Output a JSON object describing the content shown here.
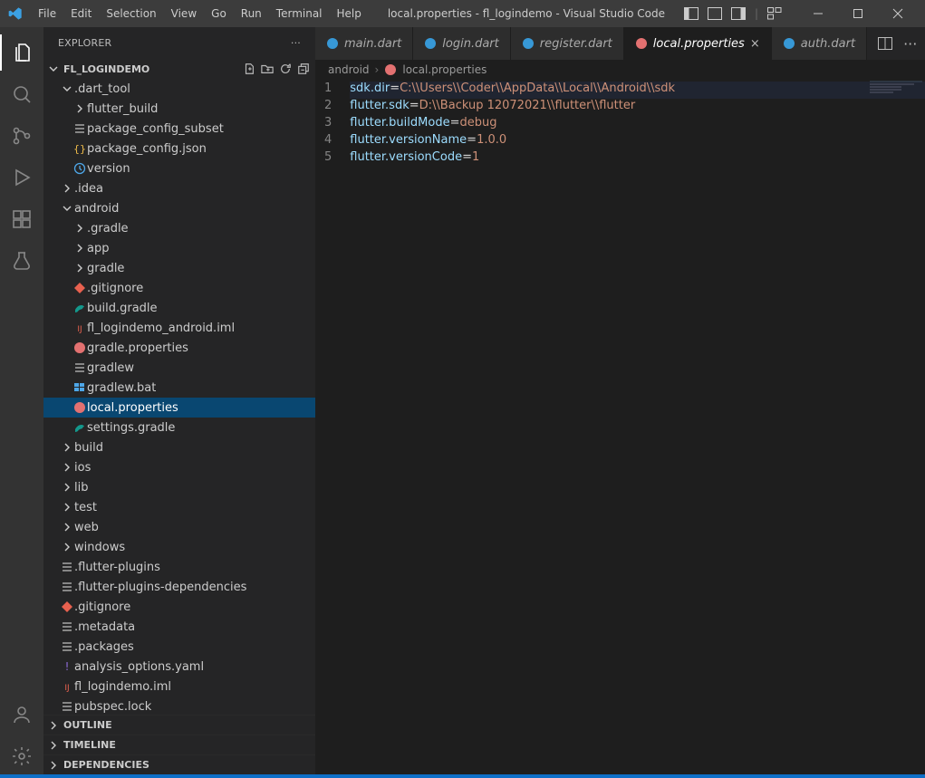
{
  "title": "local.properties - fl_logindemo - Visual Studio Code",
  "menu": [
    "File",
    "Edit",
    "Selection",
    "View",
    "Go",
    "Run",
    "Terminal",
    "Help"
  ],
  "sidebar": {
    "title": "EXPLORER",
    "project": "FL_LOGINDEMO",
    "outline": "OUTLINE",
    "timeline": "TIMELINE",
    "dependencies": "DEPENDENCIES"
  },
  "tree": [
    {
      "d": 1,
      "t": "folder",
      "e": true,
      "n": ".dart_tool"
    },
    {
      "d": 2,
      "t": "folder",
      "e": false,
      "n": "flutter_build"
    },
    {
      "d": 2,
      "t": "file",
      "i": "lines",
      "n": "package_config_subset"
    },
    {
      "d": 2,
      "t": "file",
      "i": "braces",
      "n": "package_config.json"
    },
    {
      "d": 2,
      "t": "file",
      "i": "clock",
      "n": "version"
    },
    {
      "d": 1,
      "t": "folder",
      "e": false,
      "n": ".idea"
    },
    {
      "d": 1,
      "t": "folder",
      "e": true,
      "n": "android"
    },
    {
      "d": 2,
      "t": "folder",
      "e": false,
      "n": ".gradle"
    },
    {
      "d": 2,
      "t": "folder",
      "e": false,
      "n": "app"
    },
    {
      "d": 2,
      "t": "folder",
      "e": false,
      "n": "gradle"
    },
    {
      "d": 2,
      "t": "file",
      "i": "git",
      "n": ".gitignore"
    },
    {
      "d": 2,
      "t": "file",
      "i": "gradle",
      "n": "build.gradle"
    },
    {
      "d": 2,
      "t": "file",
      "i": "xml",
      "n": "fl_logindemo_android.iml"
    },
    {
      "d": 2,
      "t": "file",
      "i": "mod",
      "n": "gradle.properties"
    },
    {
      "d": 2,
      "t": "file",
      "i": "lines",
      "n": "gradlew"
    },
    {
      "d": 2,
      "t": "file",
      "i": "win",
      "n": "gradlew.bat"
    },
    {
      "d": 2,
      "t": "file",
      "i": "mod",
      "n": "local.properties",
      "sel": true
    },
    {
      "d": 2,
      "t": "file",
      "i": "gradle",
      "n": "settings.gradle"
    },
    {
      "d": 1,
      "t": "folder",
      "e": false,
      "n": "build"
    },
    {
      "d": 1,
      "t": "folder",
      "e": false,
      "n": "ios"
    },
    {
      "d": 1,
      "t": "folder",
      "e": false,
      "n": "lib"
    },
    {
      "d": 1,
      "t": "folder",
      "e": false,
      "n": "test"
    },
    {
      "d": 1,
      "t": "folder",
      "e": false,
      "n": "web"
    },
    {
      "d": 1,
      "t": "folder",
      "e": false,
      "n": "windows"
    },
    {
      "d": 1,
      "t": "file",
      "i": "lines",
      "n": ".flutter-plugins"
    },
    {
      "d": 1,
      "t": "file",
      "i": "lines",
      "n": ".flutter-plugins-dependencies"
    },
    {
      "d": 1,
      "t": "file",
      "i": "git",
      "n": ".gitignore"
    },
    {
      "d": 1,
      "t": "file",
      "i": "lines",
      "n": ".metadata"
    },
    {
      "d": 1,
      "t": "file",
      "i": "lines",
      "n": ".packages"
    },
    {
      "d": 1,
      "t": "file",
      "i": "excl",
      "n": "analysis_options.yaml"
    },
    {
      "d": 1,
      "t": "file",
      "i": "xml",
      "n": "fl_logindemo.iml"
    },
    {
      "d": 1,
      "t": "file",
      "i": "lines",
      "n": "pubspec.lock"
    }
  ],
  "tabs": [
    {
      "label": "main.dart",
      "icon": "dart"
    },
    {
      "label": "login.dart",
      "icon": "dart"
    },
    {
      "label": "register.dart",
      "icon": "dart"
    },
    {
      "label": "local.properties",
      "icon": "mod",
      "active": true,
      "close": true
    },
    {
      "label": "auth.dart",
      "icon": "dart"
    }
  ],
  "breadcrumbs": [
    "android",
    "local.properties"
  ],
  "lineNumbers": [
    "1",
    "2",
    "3",
    "4",
    "5"
  ],
  "code": [
    [
      [
        "key",
        "sdk.dir"
      ],
      [
        "op",
        "="
      ],
      [
        "val",
        "C:\\\\Users\\\\Coder\\\\AppData\\\\Local\\\\Android\\\\sdk"
      ]
    ],
    [
      [
        "key",
        "flutter.sdk"
      ],
      [
        "op",
        "="
      ],
      [
        "val",
        "D:\\\\Backup 12072021\\\\flutter\\\\flutter"
      ]
    ],
    [
      [
        "key",
        "flutter.buildMode"
      ],
      [
        "op",
        "="
      ],
      [
        "val",
        "debug"
      ]
    ],
    [
      [
        "key",
        "flutter.versionName"
      ],
      [
        "op",
        "="
      ],
      [
        "val",
        "1.0.0"
      ]
    ],
    [
      [
        "key",
        "flutter.versionCode"
      ],
      [
        "op",
        "="
      ],
      [
        "val",
        "1"
      ]
    ]
  ]
}
